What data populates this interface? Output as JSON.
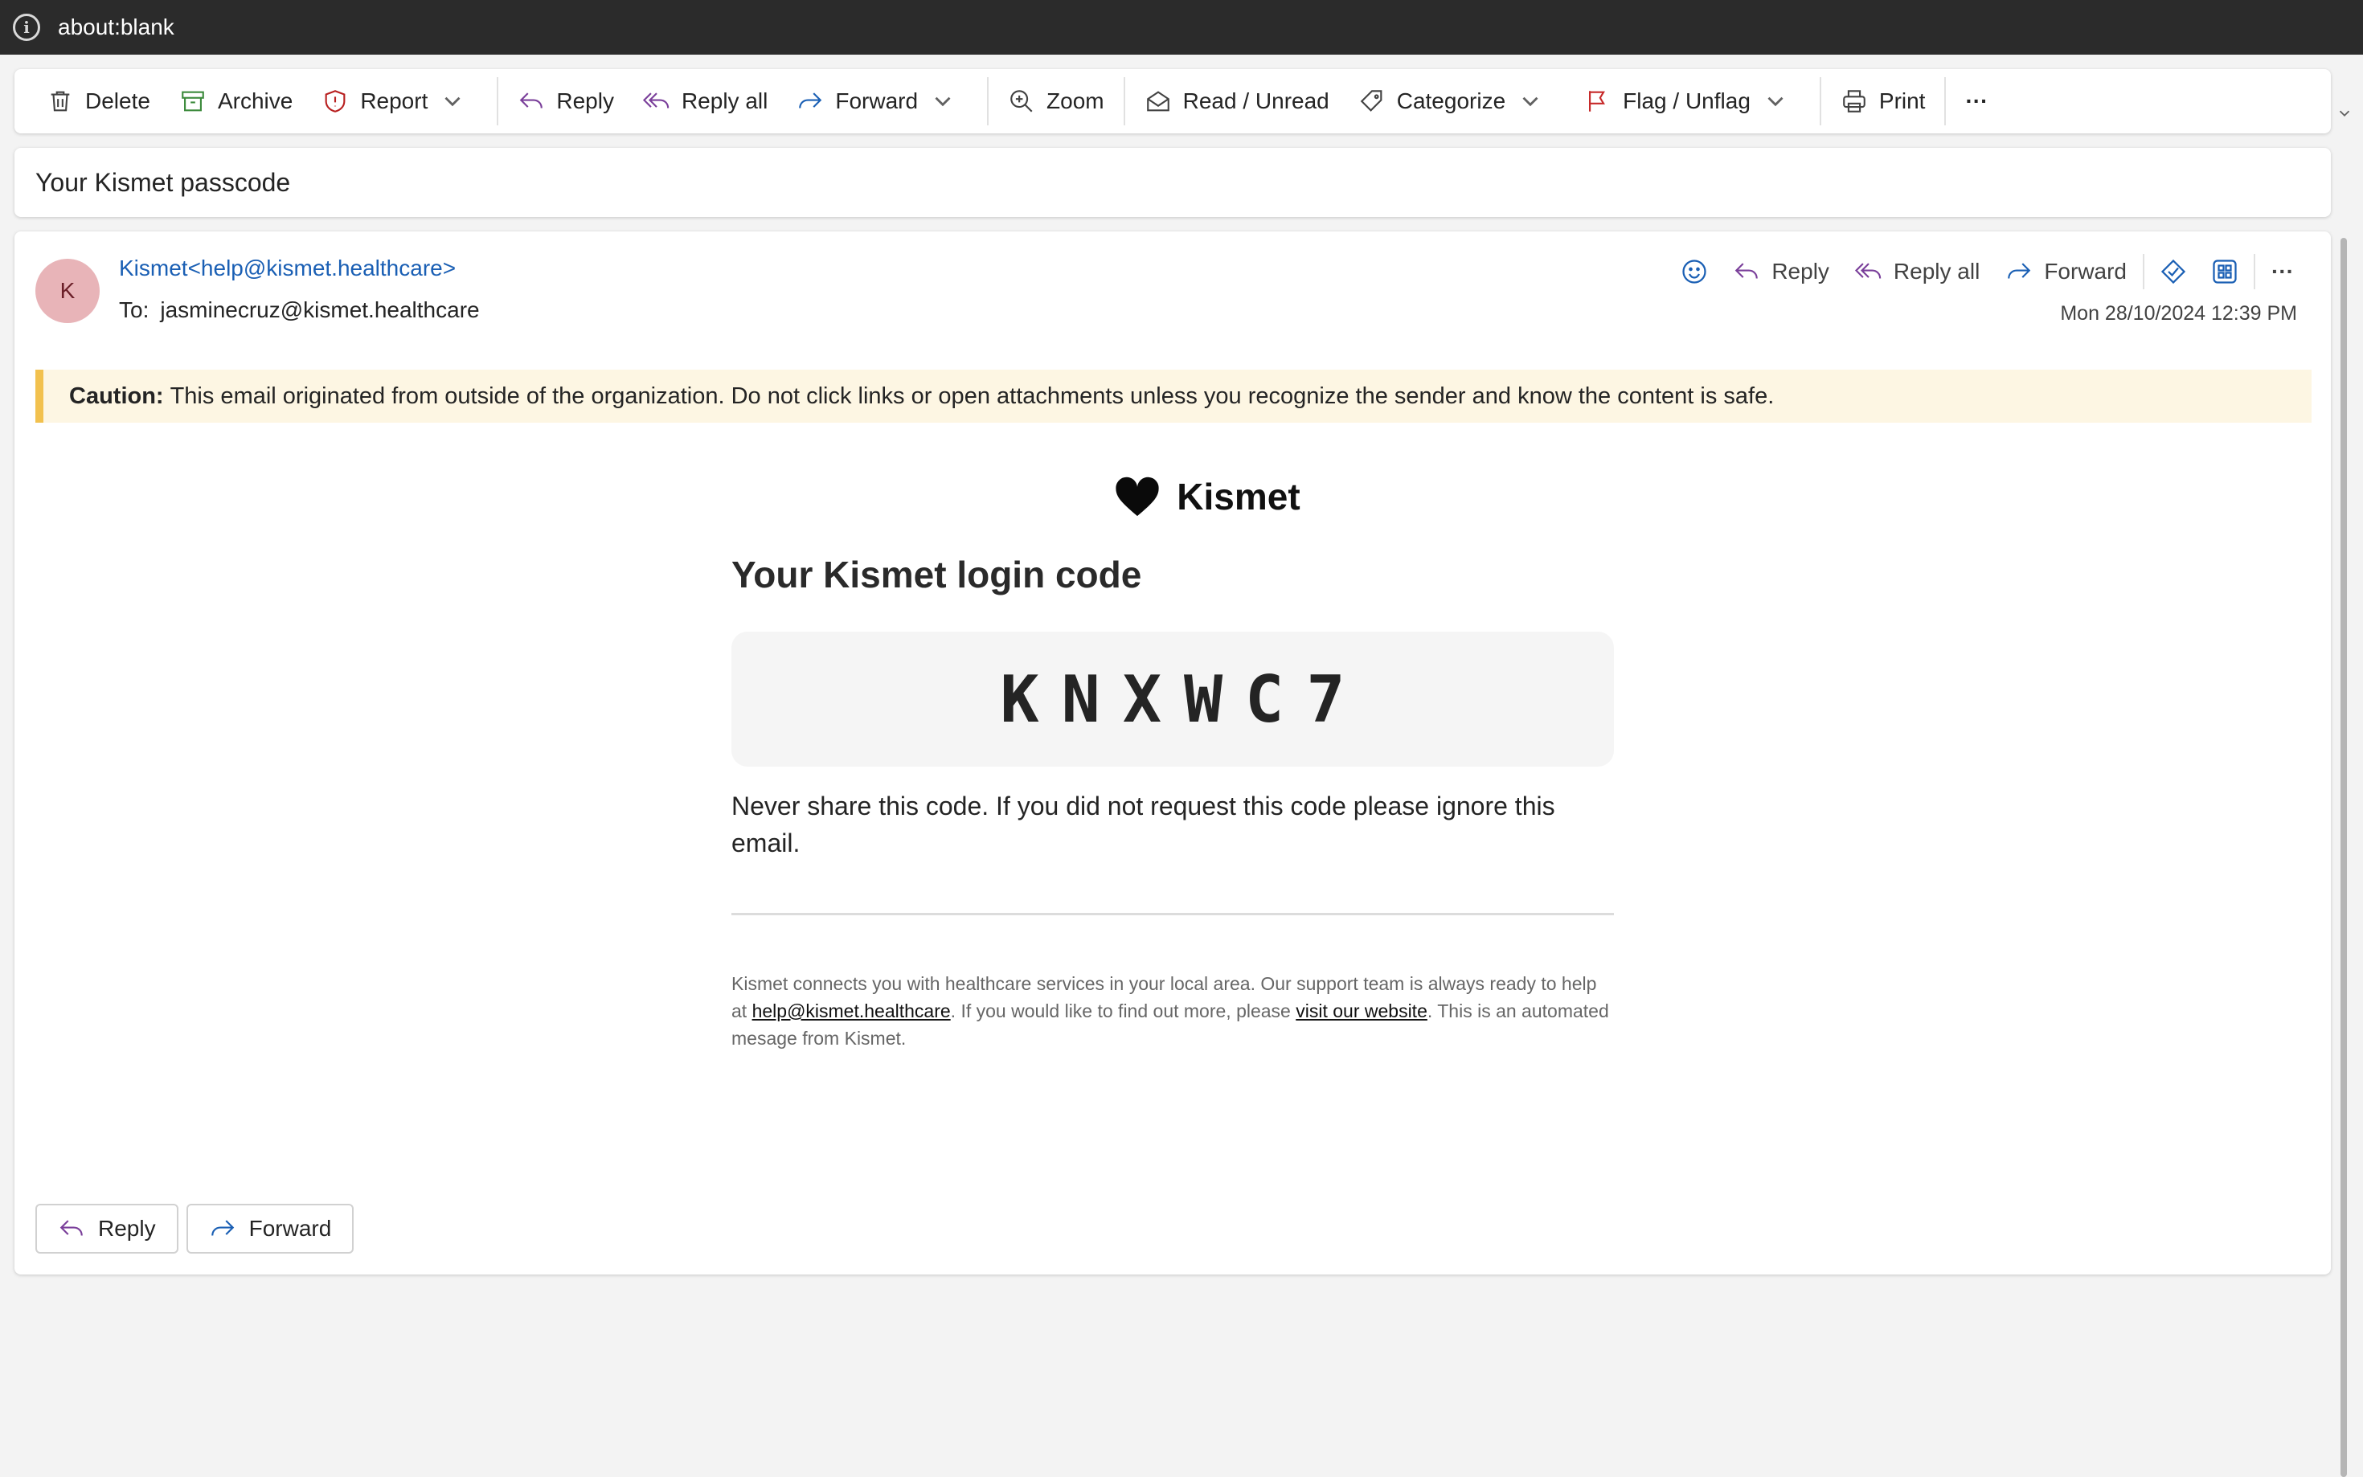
{
  "browser": {
    "url": "about:blank"
  },
  "toolbar": {
    "delete": "Delete",
    "archive": "Archive",
    "report": "Report",
    "reply": "Reply",
    "reply_all": "Reply all",
    "forward": "Forward",
    "zoom": "Zoom",
    "read_unread": "Read / Unread",
    "categorize": "Categorize",
    "flag_unflag": "Flag / Unflag",
    "print": "Print",
    "more": "···"
  },
  "subject": "Your Kismet passcode",
  "message": {
    "avatar_initial": "K",
    "sender": "Kismet<help@kismet.healthcare>",
    "to_label": "To:",
    "to_address": "jasminecruz@kismet.healthcare",
    "timestamp": "Mon 28/10/2024 12:39 PM",
    "actions": {
      "reply": "Reply",
      "reply_all": "Reply all",
      "forward": "Forward",
      "more": "···"
    }
  },
  "caution": {
    "label": "Caution:",
    "text": "This email originated from outside of the organization. Do not click links or open attachments unless you recognize the sender and know the content is safe."
  },
  "email_body": {
    "brand": "Kismet",
    "title": "Your Kismet login code",
    "code": "KNXWC7",
    "warning": "Never share this code. If you did not request this code please ignore this email.",
    "footer_1": "Kismet connects you with healthcare services in your local area. Our support team is always ready to help at ",
    "footer_email": "help@kismet.healthcare",
    "footer_2": ". If you would like to find out more, please ",
    "footer_link": "visit our website",
    "footer_3": ". This is an automated mesage from Kismet."
  },
  "bottom_actions": {
    "reply": "Reply",
    "forward": "Forward"
  },
  "colors": {
    "accent_link": "#1a5fb4",
    "caution_bar": "#f2c14e",
    "avatar_bg": "#e8b4b8"
  }
}
